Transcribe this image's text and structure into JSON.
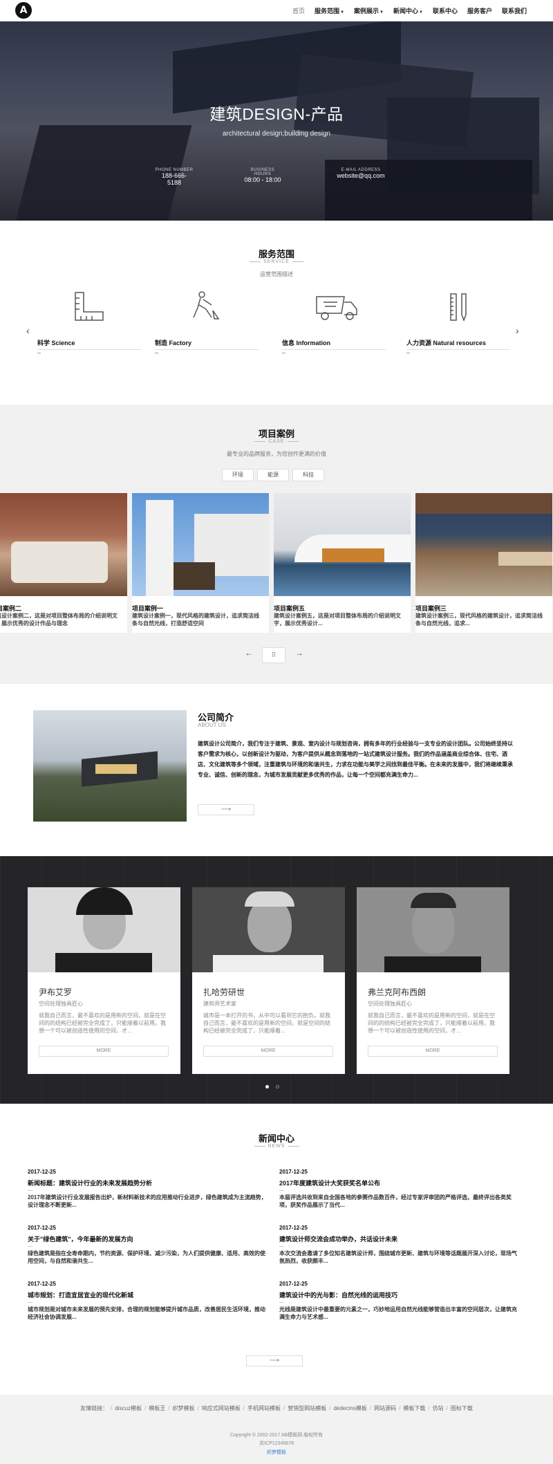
{
  "nav": {
    "logo": "A",
    "items": [
      {
        "label": "首页",
        "caret": false,
        "active": true
      },
      {
        "label": "服务范围",
        "caret": true
      },
      {
        "label": "案例展示",
        "caret": true
      },
      {
        "label": "新闻中心",
        "caret": true
      },
      {
        "label": "联系中心",
        "caret": false
      },
      {
        "label": "服务客户",
        "caret": false
      },
      {
        "label": "联系我们",
        "caret": false
      }
    ]
  },
  "hero": {
    "title": "建筑DESIGN-产品",
    "subtitle": "architectural design;building design",
    "info": [
      {
        "label": "PHONE NUMBER",
        "value": "188-666-5188"
      },
      {
        "label": "BUSINESS HOURS",
        "value": "08:00 - 18:00"
      },
      {
        "label": "E-MAIL ADDRESS",
        "value": "website@qq.com"
      }
    ]
  },
  "service": {
    "title": "服务范围",
    "en": "SERVICE",
    "desc": "运营范围描述",
    "items": [
      {
        "icon": "ruler-square-icon",
        "name": "科学 Science"
      },
      {
        "icon": "worker-shovel-icon",
        "name": "制造 Factory"
      },
      {
        "icon": "dump-truck-icon",
        "name": "信息 Information"
      },
      {
        "icon": "ruler-pencil-icon",
        "name": "人力资源 Natural resources"
      }
    ],
    "prev": "‹",
    "next": "›"
  },
  "cases": {
    "title": "项目案例",
    "en": "CASE",
    "desc": "最专业的品牌服务，为您创作更满的价值",
    "filters": [
      "环境",
      "能源",
      "科技"
    ],
    "items": [
      {
        "name": "项目案例二",
        "text": "建筑设计案例二，这是对项目整体布局的介绍说明文字，展示优秀的设计作品与理念"
      },
      {
        "name": "项目案例一",
        "text": "建筑设计案例一，现代风格的建筑设计，追求简洁线条与自然光线，打造舒适空间"
      },
      {
        "name": "项目案例五",
        "text": "建筑设计案例五，这是对项目整体布局的介绍说明文字，展示优秀设计..."
      },
      {
        "name": "项目案例三",
        "text": "建筑设计案例三，现代风格的建筑设计，追求简洁线条与自然光线，追求..."
      }
    ],
    "prev": "←",
    "next": "→",
    "grid": "⠿"
  },
  "about": {
    "title": "公司简介",
    "en": "ABOUT US",
    "text": "建筑设计公司简介，我们专注于建筑、景观、室内设计与规划咨询，拥有多年的行业经验与一支专业的设计团队。公司始终坚持以客户需求为核心，以创新设计为驱动，为客户提供从概念到落地的一站式建筑设计服务。我们的作品涵盖商业综合体、住宅、酒店、文化建筑等多个领域，注重建筑与环境的和谐共生，力求在功能与美学之间找到最佳平衡。在未来的发展中，我们将继续秉承专业、诚信、创新的理念，为城市发展贡献更多优秀的作品，让每一个空间都充满生命力...",
    "more": "⟶"
  },
  "team": {
    "members": [
      {
        "name": "尹布艾罗",
        "role": "空间处理独具匠心",
        "desc": "就我自己而言，最不喜欢的是用新的空间，就是在空间的的结构已经被完全完成了，只能顺着以前用。我想一个可以被创造性使用的空间，才..."
      },
      {
        "name": "扎哈劳研世",
        "role": "建筑师艺术家",
        "desc": "城市是一本打开的书，从中可以看到它的抱负。就我自己而言，最不喜欢的是用新的空间，就是空间的结构已经被完全完成了，只能顺着..."
      },
      {
        "name": "弗兰克阿布西朗",
        "role": "空间处理独具匠心",
        "desc": "就我自己而言，最不喜欢的是用新的空间，就是在空间的的结构已经被完全完成了，只能顺着以前用。我想一个可以被创造性使用的空间，才..."
      }
    ],
    "more": "MORE"
  },
  "news": {
    "title": "新闻中心",
    "en": "NEWS",
    "items": [
      {
        "date": "2017-12-25",
        "title": "新闻标题：建筑设计行业的未来发展趋势分析",
        "text": "2017年建筑设计行业发展报告出炉，新材料新技术的应用推动行业进步，绿色建筑成为主流趋势，设计理念不断更新..."
      },
      {
        "date": "2017-12-25",
        "title": "2017年度建筑设计大奖获奖名单公布",
        "text": "本届评选共收到来自全国各地的参赛作品数百件，经过专家评审团的严格评选，最终评出各类奖项，获奖作品展示了当代..."
      },
      {
        "date": "2017-12-25",
        "title": "关于\"绿色建筑\"，今年最新的发展方向",
        "text": "绿色建筑是指在全寿命期内，节约资源、保护环境、减少污染，为人们提供健康、适用、高效的使用空间，与自然和谐共生..."
      },
      {
        "date": "2017-12-25",
        "title": "建筑设计师交流会成功举办，共话设计未来",
        "text": "本次交流会邀请了多位知名建筑设计师，围绕城市更新、建筑与环境等话题展开深入讨论，现场气氛热烈，收获颇丰..."
      },
      {
        "date": "2017-12-25",
        "title": "城市规划：打造宜居宜业的现代化新城",
        "text": "城市规划是对城市未来发展的预先安排，合理的规划能够提升城市品质，改善居民生活环境，推动经济社会协调发展..."
      },
      {
        "date": "2017-12-25",
        "title": "建筑设计中的光与影：自然光线的运用技巧",
        "text": "光线是建筑设计中最重要的元素之一，巧妙地运用自然光线能够营造出丰富的空间层次，让建筑充满生命力与艺术感..."
      }
    ],
    "more": "⟶"
  },
  "footer": {
    "links_label": "友情链接：",
    "links": [
      "discuz模板",
      "模板王",
      "织梦模板",
      "响应式网站模板",
      "手机网站模板",
      "营销型网站模板",
      "dedecms模板",
      "网站源码",
      "模板下载",
      "仿站",
      "图标下载"
    ],
    "copyright": "Copyright © 2002-2017 AB模板网 版权所有",
    "icp": "苏ICP12345678",
    "powered": "织梦模板"
  },
  "colors": {
    "accent_blue": "#3a7bd5",
    "dark_band": "#252527",
    "light_band": "#f1f1f1"
  }
}
